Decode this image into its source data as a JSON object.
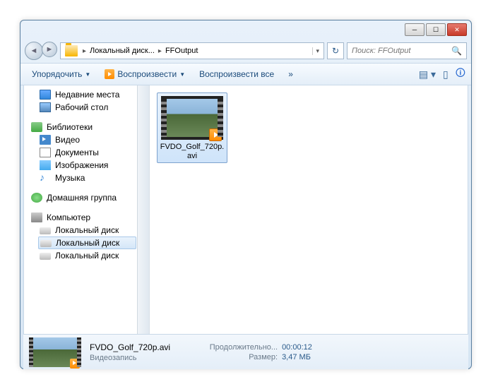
{
  "breadcrumb": {
    "part1": "Локальный диск...",
    "part2": "FFOutput"
  },
  "search": {
    "placeholder": "Поиск: FFOutput"
  },
  "toolbar": {
    "organize": "Упорядочить",
    "play": "Воспроизвести",
    "play_all": "Воспроизвести все",
    "overflow": "»"
  },
  "sidebar": {
    "recent": "Недавние места",
    "desktop": "Рабочий стол",
    "libraries": "Библиотеки",
    "video": "Видео",
    "documents": "Документы",
    "images": "Изображения",
    "music": "Музыка",
    "homegroup": "Домашняя группа",
    "computer": "Компьютер",
    "disk1": "Локальный диск",
    "disk2": "Локальный диск",
    "disk3": "Локальный диск"
  },
  "file": {
    "name": "FVDO_Golf_720p.avi"
  },
  "details": {
    "name": "FVDO_Golf_720p.avi",
    "type": "Видеозапись",
    "duration_label": "Продолжительно...",
    "duration_value": "00:00:12",
    "size_label": "Размер:",
    "size_value": "3,47 МБ"
  }
}
